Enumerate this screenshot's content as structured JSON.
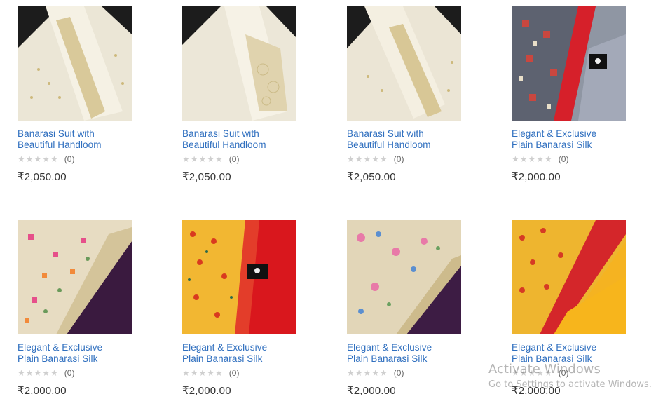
{
  "products": [
    {
      "title_line1": "Banarasi Suit with",
      "title_line2": "Beautiful Handloom",
      "stars": "★★★★★",
      "reviews": "(0)",
      "price": "₹2,050.00",
      "image": "ivory-suit-photo"
    },
    {
      "title_line1": "Banarasi Suit with",
      "title_line2": "Beautiful Handloom",
      "stars": "★★★★★",
      "reviews": "(0)",
      "price": "₹2,050.00",
      "image": "ivory-suit-photo"
    },
    {
      "title_line1": "Banarasi Suit with",
      "title_line2": "Beautiful Handloom",
      "stars": "★★★★★",
      "reviews": "(0)",
      "price": "₹2,050.00",
      "image": "ivory-suit-photo"
    },
    {
      "title_line1": "Elegant & Exclusive",
      "title_line2": "Plain Banarasi Silk",
      "stars": "★★★★★",
      "reviews": "(0)",
      "price": "₹2,000.00",
      "image": "grey-red-saree-photo"
    },
    {
      "title_line1": "Elegant & Exclusive",
      "title_line2": "Plain Banarasi Silk",
      "stars": "★★★★★",
      "reviews": "(0)",
      "price": "₹2,000.00",
      "image": "cream-purple-saree-photo"
    },
    {
      "title_line1": "Elegant & Exclusive",
      "title_line2": "Plain Banarasi Silk",
      "stars": "★★★★★",
      "reviews": "(0)",
      "price": "₹2,000.00",
      "image": "yellow-red-saree-photo"
    },
    {
      "title_line1": "Elegant & Exclusive",
      "title_line2": "Plain Banarasi Silk",
      "stars": "★★★★★",
      "reviews": "(0)",
      "price": "₹2,000.00",
      "image": "cream-purple-floral-saree-photo"
    },
    {
      "title_line1": "Elegant & Exclusive",
      "title_line2": "Plain Banarasi Silk",
      "stars": "★★★★★",
      "reviews": "(0)",
      "price": "₹2,000.00",
      "image": "yellow-red-saree-photo"
    }
  ],
  "watermark": {
    "title": "Activate Windows",
    "subtitle": "Go to Settings to activate Windows."
  },
  "colors": {
    "link": "#2f6fbf",
    "price": "#333333",
    "star_empty": "#cfcfcf"
  }
}
